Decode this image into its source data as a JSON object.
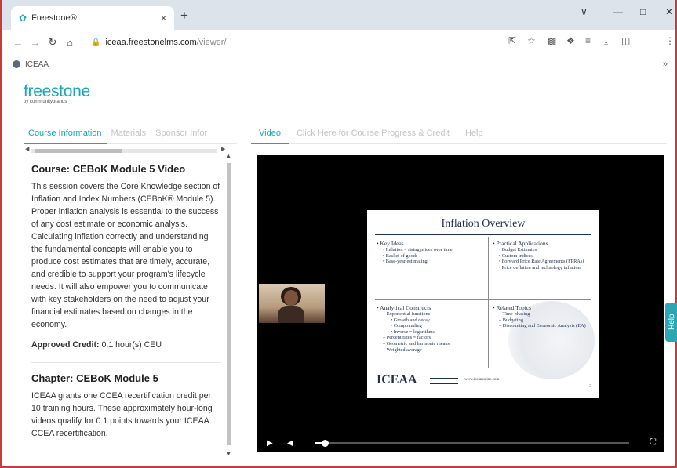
{
  "browser": {
    "tab_title": "Freestone®",
    "tab_close": "×",
    "new_tab": "+",
    "url_host": "iceaa.freestonelms.com",
    "url_path": "/viewer/",
    "bookmark": "ICEAA",
    "window_controls": [
      "∨",
      "—",
      "□",
      "✕"
    ]
  },
  "app": {
    "brand": "freestone",
    "brand_sub": "by communitybrands"
  },
  "left_panel": {
    "tabs": [
      "Course Information",
      "Materials",
      "Sponsor Infor"
    ],
    "course_label": "Course:",
    "course_title": "CEBoK Module 5 Video",
    "course_desc": "This session covers the Core Knowledge section of Inflation and Index Numbers (CEBoK® Module 5). Proper inflation analysis is essential to the success of any cost estimate or economic analysis. Calculating inflation correctly and understanding the fundamental concepts will enable you to produce cost estimates that are timely, accurate, and credible to support your program's lifecycle needs. It will also empower you to communicate with key stakeholders on the need to adjust your financial estimates based on changes in the economy.",
    "credit_label": "Approved Credit:",
    "credit_value": "0.1 hour(s) CEU",
    "chapter_label": "Chapter:",
    "chapter_title": "CEBoK Module 5",
    "chapter_desc": "ICEAA grants one CCEA recertification credit per 10 training hours. These approximately hour-long videos qualify for 0.1 points towards your ICEAA CCEA recertification."
  },
  "right_panel": {
    "tabs": [
      "Video",
      "Click Here for Course Progress & Credit",
      "Help"
    ]
  },
  "slide": {
    "title": "Inflation Overview",
    "q1": {
      "heading": "Key Ideas",
      "items": [
        "Inflation = rising prices over time",
        "Basket of goods",
        "Base-year estimating"
      ]
    },
    "q2": {
      "heading": "Practical Applications",
      "items": [
        "Budget Estimates",
        "Custom indices",
        "Forward Price Rate Agreements (FPRAs)",
        "Price deflation and technology inflation"
      ]
    },
    "q3": {
      "heading": "Analytical Constructs",
      "sub": "Exponential functions",
      "sub_items": [
        "Growth and decay",
        "Compounding",
        "Inverse = logarithms"
      ],
      "items": [
        "Percent rates = factors",
        "Geometric and harmonic means",
        "Weighted average"
      ]
    },
    "q4": {
      "heading": "Related Topics",
      "items": [
        "Time-phasing",
        "Budgeting",
        "Discounting and Economic Analysis (EA)"
      ]
    },
    "logo": "ICEAA",
    "url": "www.iceaaonline.com",
    "page": "2"
  },
  "player": {
    "progress_fraction": 0.03,
    "play_icon": "▶",
    "volume_icon": "◀",
    "fullscreen_icon": "⛶"
  },
  "help_tab": "Help"
}
